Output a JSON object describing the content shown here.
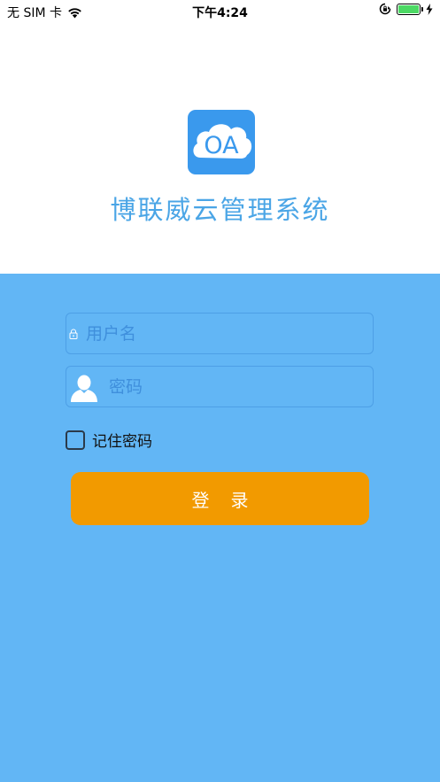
{
  "status_bar": {
    "carrier": "无 SIM 卡",
    "time": "下午4:24",
    "icons": [
      "wifi-icon",
      "rotation-lock-icon",
      "battery-icon",
      "charging-icon"
    ],
    "battery_level": 1.0
  },
  "header": {
    "logo_text": "OA",
    "app_title": "博联威云管理系统"
  },
  "login": {
    "username_placeholder": "用户名",
    "username_value": "",
    "password_placeholder": "密码",
    "password_value": "",
    "remember_label": "记住密码",
    "remember_checked": false,
    "submit_label": "登录"
  },
  "colors": {
    "background_top": "#ffffff",
    "background_bottom": "#62b6f5",
    "logo_bg": "#3a99ed",
    "title_text": "#4aa5e6",
    "button_bg": "#f29a00",
    "button_text": "#ffffff",
    "battery_fill": "#4cd964"
  }
}
